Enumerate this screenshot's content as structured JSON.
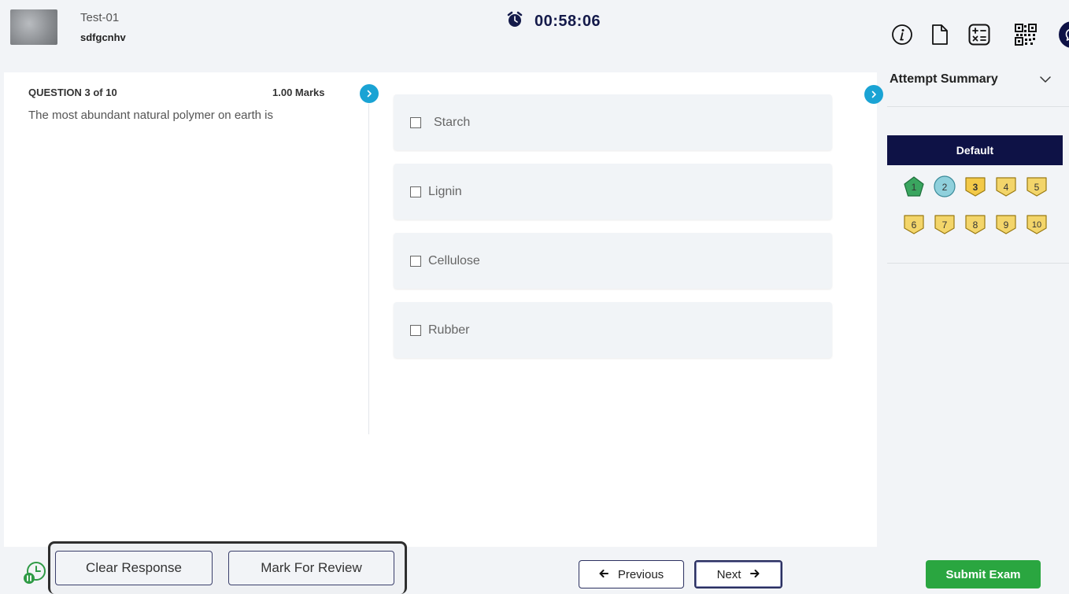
{
  "header": {
    "exam_title": "Test-01",
    "user_name": "sdfgcnhv",
    "timer": "00:58:06",
    "icons": [
      "info-icon",
      "document-icon",
      "calculator-icon",
      "qr-code-icon",
      "chat-icon"
    ]
  },
  "question": {
    "number_label": "QUESTION 3 of 10",
    "marks": "1.00 Marks",
    "text": "The most abundant natural polymer on earth is",
    "options": [
      {
        "label": "Starch"
      },
      {
        "label": "Lignin"
      },
      {
        "label": "Cellulose"
      },
      {
        "label": "Rubber"
      }
    ]
  },
  "sidebar": {
    "title": "Attempt Summary",
    "section": "Default",
    "palette": [
      {
        "label": "1",
        "status": "answered",
        "color": "#3aa55f"
      },
      {
        "label": "2",
        "status": "not-answered",
        "color": "#8fd0dc"
      },
      {
        "label": "3",
        "status": "current",
        "color": "#f3c948"
      },
      {
        "label": "4",
        "status": "not-visited",
        "color": "#f3d56a"
      },
      {
        "label": "5",
        "status": "not-visited",
        "color": "#f3d56a"
      },
      {
        "label": "6",
        "status": "not-visited",
        "color": "#f3d56a"
      },
      {
        "label": "7",
        "status": "not-visited",
        "color": "#f3d56a"
      },
      {
        "label": "8",
        "status": "not-visited",
        "color": "#f3d56a"
      },
      {
        "label": "9",
        "status": "not-visited",
        "color": "#f3d56a"
      },
      {
        "label": "10",
        "status": "not-visited",
        "color": "#f3d56a"
      }
    ]
  },
  "footer": {
    "clear_label": "Clear Response",
    "review_label": "Mark For Review",
    "previous_label": "Previous",
    "next_label": "Next",
    "submit_label": "Submit Exam"
  },
  "colors": {
    "accent": "#0e1246",
    "submit": "#2aa640",
    "expand": "#1aa3d4"
  }
}
